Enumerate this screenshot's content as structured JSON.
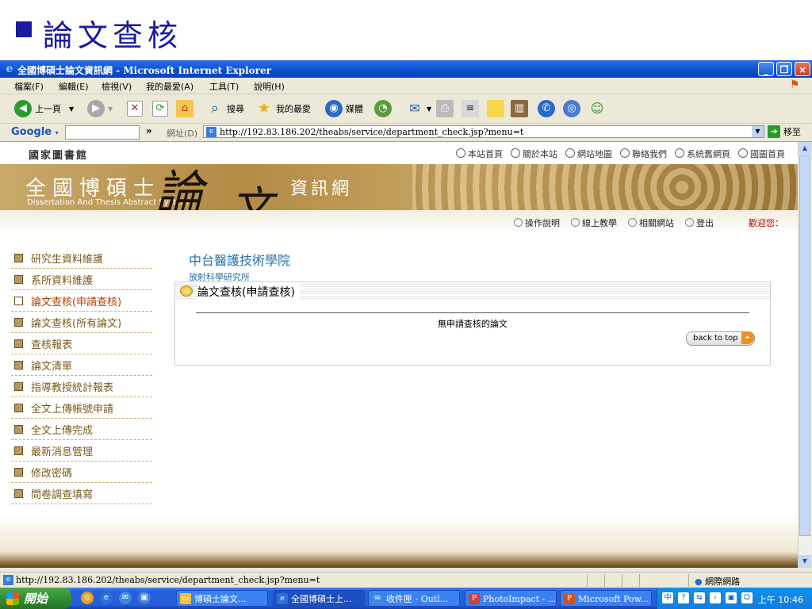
{
  "slide": {
    "title": "論文查核"
  },
  "window": {
    "title": "全國博碩士論文資訊網 - Microsoft Internet Explorer",
    "controls": [
      "minimize",
      "maximize",
      "close"
    ]
  },
  "menu": [
    "檔案(F)",
    "編輯(E)",
    "檢視(V)",
    "我的最愛(A)",
    "工具(T)",
    "說明(H)"
  ],
  "toolbar": {
    "back": "上一頁",
    "search": "搜尋",
    "favorites": "我的最愛",
    "media": "媒體"
  },
  "addressbar": {
    "google": "Google",
    "chevron": "»",
    "label": "網址(D)",
    "url": "http://192.83.186.202/theabs/service/department_check.jsp?menu=t",
    "go": "移至"
  },
  "site": {
    "library": "國家圖書館",
    "toplinks": [
      "本站首頁",
      "關於本站",
      "網站地圖",
      "聯絡我們",
      "系統舊網頁",
      "國圖首頁"
    ],
    "banner_cn": "全國博碩士",
    "banner_en": "Dissertation And Thesis Abstract  System",
    "banner_big1": "論",
    "banner_big2": "文",
    "banner_sub": "資訊網",
    "subnav": [
      "操作說明",
      "線上教學",
      "相關網站",
      "登出"
    ],
    "welcome": "歡迎您："
  },
  "sidemenu": [
    "研究生資料維護",
    "系所資料維護",
    "論文查核(申請查核)",
    "論文查核(所有論文)",
    "查核報表",
    "論文清單",
    "指導教授統計報表",
    "全文上傳帳號申請",
    "全文上傳完成",
    "最新消息管理",
    "修改密碼",
    "問卷調查填寫"
  ],
  "main": {
    "institution": "中台醫護技術學院",
    "department": "放射科學研究所",
    "panel_title": "論文查核(申請查核)",
    "message": "無申請查核的論文",
    "back_to_top": "back to top"
  },
  "statusbar": {
    "url": "http://192.83.186.202/theabs/service/department_check.jsp?menu=t",
    "zone": "網際網路"
  },
  "taskbar": {
    "start": "開始",
    "tasks": [
      "博碩士論文...",
      "全國博碩士上...",
      "收件匣 - Outl...",
      "PhotoImpact - ...",
      "Microsoft Pow..."
    ],
    "clock": "上午 10:46"
  },
  "colors": {
    "accent": "#1c1aa0",
    "menu_text": "#7a5a1c",
    "active_menu": "#b04000",
    "title_blue": "#2a70a8"
  }
}
